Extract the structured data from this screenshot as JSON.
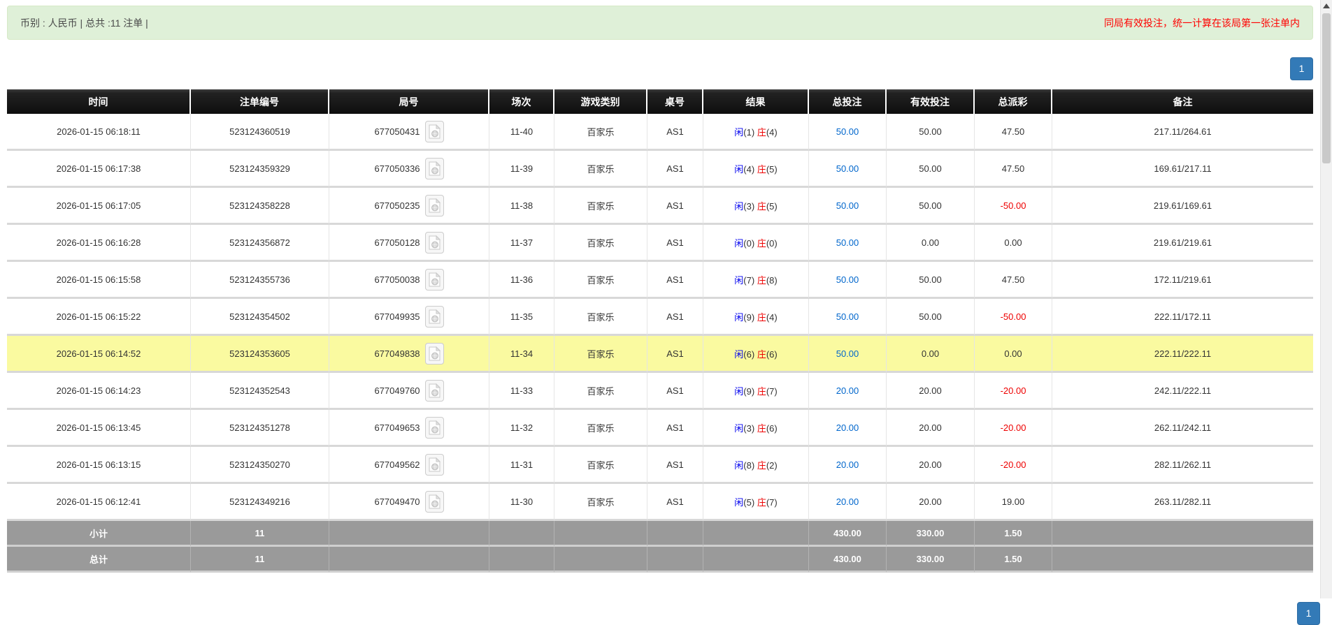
{
  "topbar": {
    "summary": "币别 : 人民币 | 总共 :11 注单 |",
    "notice": "同局有效投注，统一计算在该局第一张注单内"
  },
  "pagination": {
    "current": "1"
  },
  "icons": {
    "round_video": "video-replay-icon",
    "scroll_up": "scroll-up-arrow-icon"
  },
  "colors": {
    "summary_bg": "#dff0d8",
    "notice_red": "#ff0000",
    "header_bg": "#1a1a1a",
    "footer_bg": "#9a9a9a",
    "highlight_yellow": "#fafaa0",
    "link_blue": "#0066cc",
    "player_blue": "#0000ee",
    "banker_red": "#ee0000",
    "pager_blue": "#337ab7"
  },
  "table": {
    "columns": [
      "时间",
      "注单编号",
      "局号",
      "场次",
      "游戏类别",
      "桌号",
      "结果",
      "总投注",
      "有效投注",
      "总派彩",
      "备注"
    ],
    "rows": [
      {
        "time": "2026-01-15 06:18:11",
        "bet_id": "523124360519",
        "round_id": "677050431",
        "session": "11-40",
        "game": "百家乐",
        "table_no": "AS1",
        "player": "闲",
        "player_pts": "(1)",
        "banker": "庄",
        "banker_pts": "(4)",
        "total_bet": "50.00",
        "valid_bet": "50.00",
        "payout": "47.50",
        "remark": "217.11/264.61",
        "highlight": false
      },
      {
        "time": "2026-01-15 06:17:38",
        "bet_id": "523124359329",
        "round_id": "677050336",
        "session": "11-39",
        "game": "百家乐",
        "table_no": "AS1",
        "player": "闲",
        "player_pts": "(4)",
        "banker": "庄",
        "banker_pts": "(5)",
        "total_bet": "50.00",
        "valid_bet": "50.00",
        "payout": "47.50",
        "remark": "169.61/217.11",
        "highlight": false
      },
      {
        "time": "2026-01-15 06:17:05",
        "bet_id": "523124358228",
        "round_id": "677050235",
        "session": "11-38",
        "game": "百家乐",
        "table_no": "AS1",
        "player": "闲",
        "player_pts": "(3)",
        "banker": "庄",
        "banker_pts": "(5)",
        "total_bet": "50.00",
        "valid_bet": "50.00",
        "payout": "-50.00",
        "remark": "219.61/169.61",
        "highlight": false
      },
      {
        "time": "2026-01-15 06:16:28",
        "bet_id": "523124356872",
        "round_id": "677050128",
        "session": "11-37",
        "game": "百家乐",
        "table_no": "AS1",
        "player": "闲",
        "player_pts": "(0)",
        "banker": "庄",
        "banker_pts": "(0)",
        "total_bet": "50.00",
        "valid_bet": "0.00",
        "payout": "0.00",
        "remark": "219.61/219.61",
        "highlight": false
      },
      {
        "time": "2026-01-15 06:15:58",
        "bet_id": "523124355736",
        "round_id": "677050038",
        "session": "11-36",
        "game": "百家乐",
        "table_no": "AS1",
        "player": "闲",
        "player_pts": "(7)",
        "banker": "庄",
        "banker_pts": "(8)",
        "total_bet": "50.00",
        "valid_bet": "50.00",
        "payout": "47.50",
        "remark": "172.11/219.61",
        "highlight": false
      },
      {
        "time": "2026-01-15 06:15:22",
        "bet_id": "523124354502",
        "round_id": "677049935",
        "session": "11-35",
        "game": "百家乐",
        "table_no": "AS1",
        "player": "闲",
        "player_pts": "(9)",
        "banker": "庄",
        "banker_pts": "(4)",
        "total_bet": "50.00",
        "valid_bet": "50.00",
        "payout": "-50.00",
        "remark": "222.11/172.11",
        "highlight": false
      },
      {
        "time": "2026-01-15 06:14:52",
        "bet_id": "523124353605",
        "round_id": "677049838",
        "session": "11-34",
        "game": "百家乐",
        "table_no": "AS1",
        "player": "闲",
        "player_pts": "(6)",
        "banker": "庄",
        "banker_pts": "(6)",
        "total_bet": "50.00",
        "valid_bet": "0.00",
        "payout": "0.00",
        "remark": "222.11/222.11",
        "highlight": true
      },
      {
        "time": "2026-01-15 06:14:23",
        "bet_id": "523124352543",
        "round_id": "677049760",
        "session": "11-33",
        "game": "百家乐",
        "table_no": "AS1",
        "player": "闲",
        "player_pts": "(9)",
        "banker": "庄",
        "banker_pts": "(7)",
        "total_bet": "20.00",
        "valid_bet": "20.00",
        "payout": "-20.00",
        "remark": "242.11/222.11",
        "highlight": false
      },
      {
        "time": "2026-01-15 06:13:45",
        "bet_id": "523124351278",
        "round_id": "677049653",
        "session": "11-32",
        "game": "百家乐",
        "table_no": "AS1",
        "player": "闲",
        "player_pts": "(3)",
        "banker": "庄",
        "banker_pts": "(6)",
        "total_bet": "20.00",
        "valid_bet": "20.00",
        "payout": "-20.00",
        "remark": "262.11/242.11",
        "highlight": false
      },
      {
        "time": "2026-01-15 06:13:15",
        "bet_id": "523124350270",
        "round_id": "677049562",
        "session": "11-31",
        "game": "百家乐",
        "table_no": "AS1",
        "player": "闲",
        "player_pts": "(8)",
        "banker": "庄",
        "banker_pts": "(2)",
        "total_bet": "20.00",
        "valid_bet": "20.00",
        "payout": "-20.00",
        "remark": "282.11/262.11",
        "highlight": false
      },
      {
        "time": "2026-01-15 06:12:41",
        "bet_id": "523124349216",
        "round_id": "677049470",
        "session": "11-30",
        "game": "百家乐",
        "table_no": "AS1",
        "player": "闲",
        "player_pts": "(5)",
        "banker": "庄",
        "banker_pts": "(7)",
        "total_bet": "20.00",
        "valid_bet": "20.00",
        "payout": "19.00",
        "remark": "263.11/282.11",
        "highlight": false
      }
    ],
    "footer": [
      {
        "label": "小计",
        "count": "11",
        "total_bet": "430.00",
        "valid_bet": "330.00",
        "payout": "1.50"
      },
      {
        "label": "总计",
        "count": "11",
        "total_bet": "430.00",
        "valid_bet": "330.00",
        "payout": "1.50"
      }
    ]
  }
}
